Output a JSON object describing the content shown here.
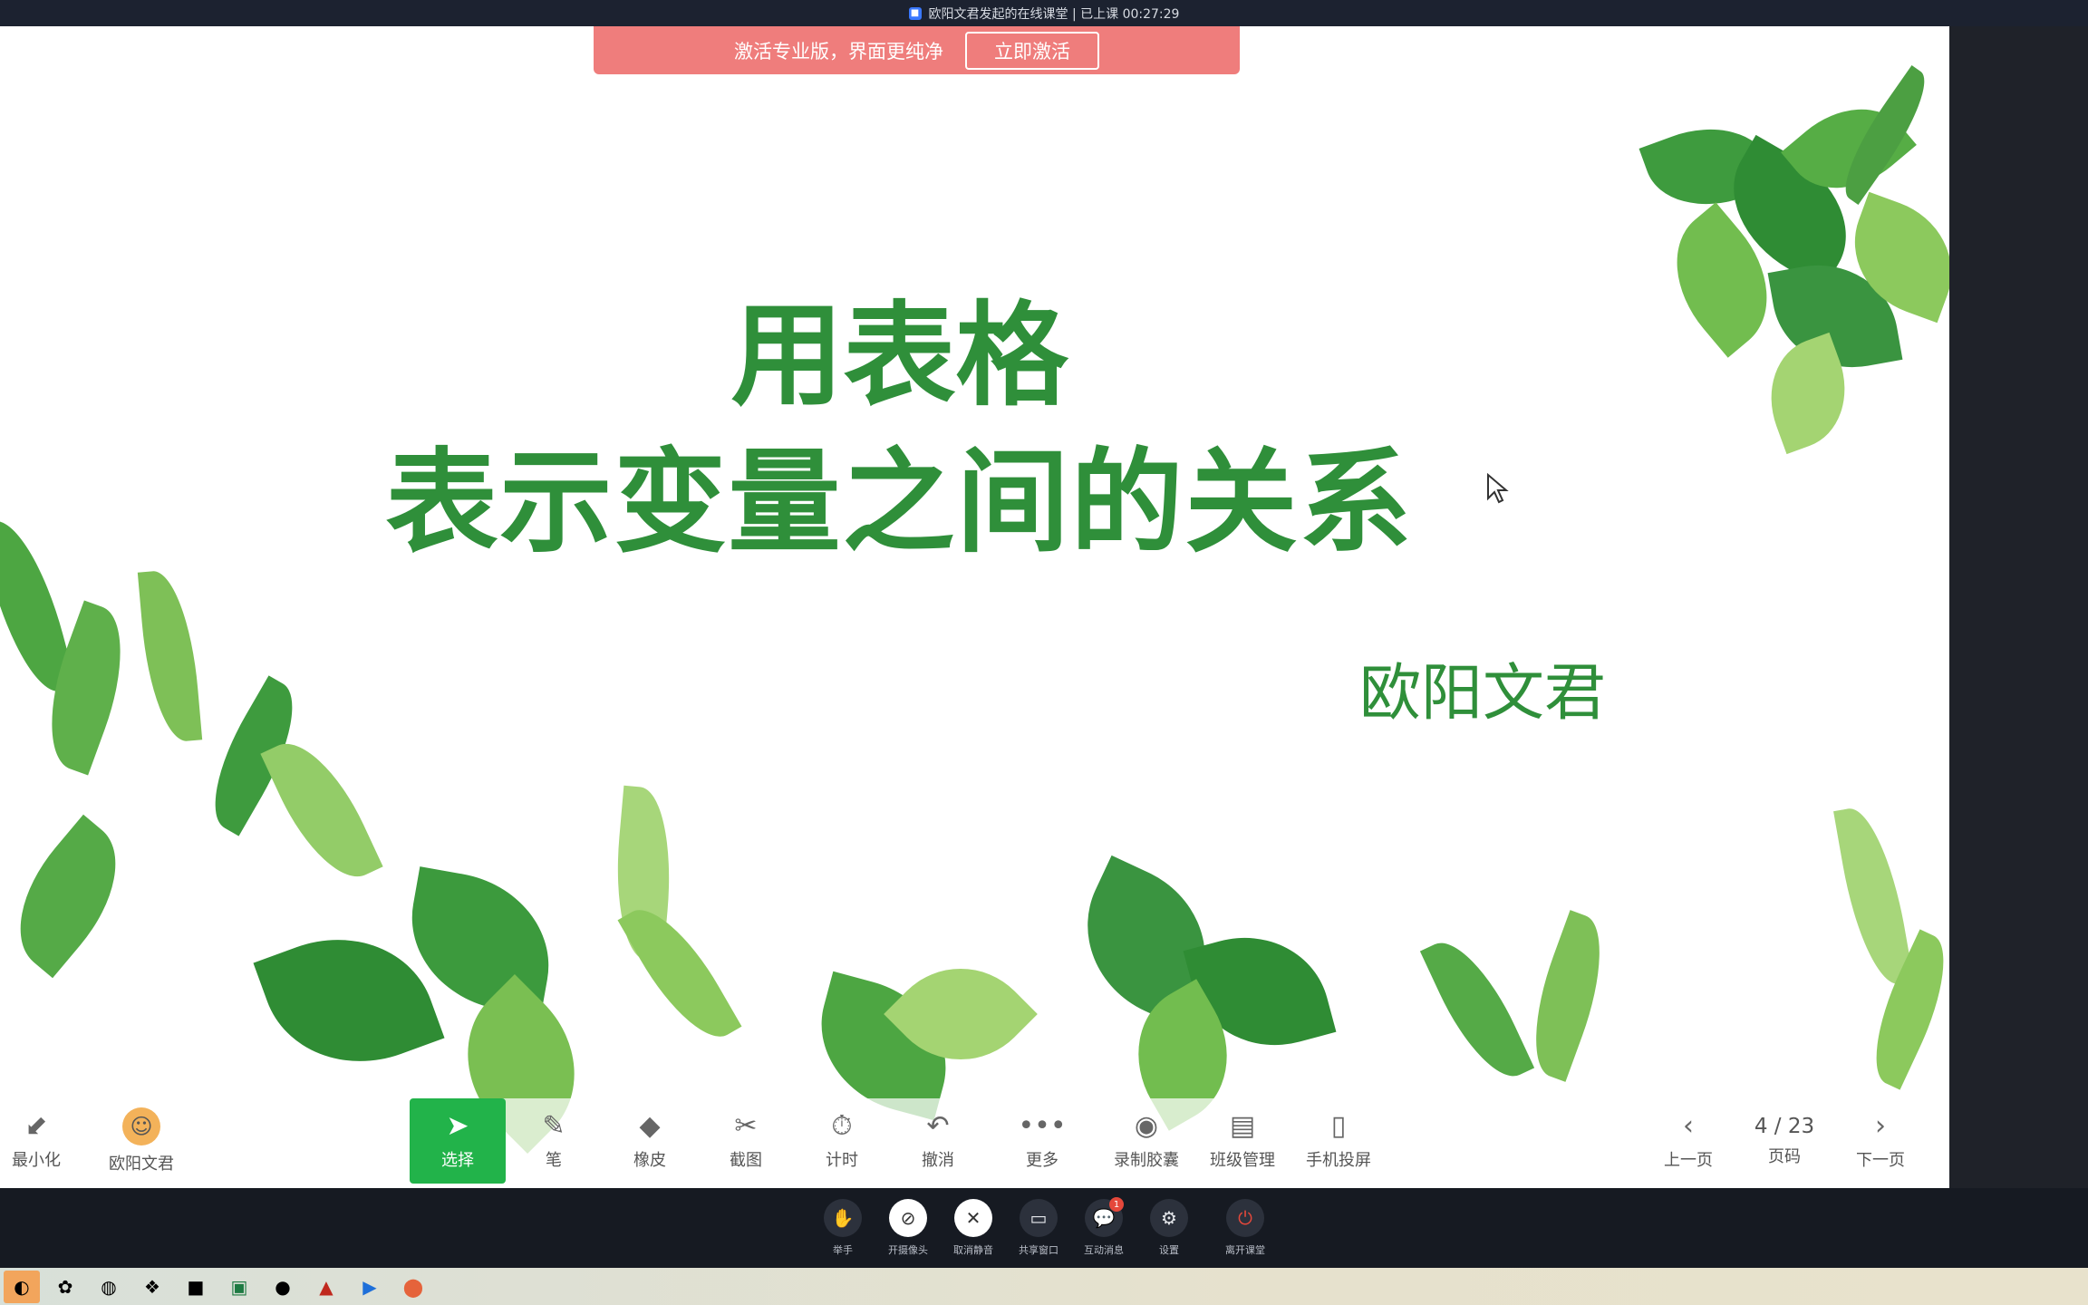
{
  "window": {
    "title": "欧阳文君发起的在线课堂 | 已上课 00:27:29"
  },
  "promo": {
    "message": "激活专业版，界面更纯净",
    "button": "立即激活"
  },
  "slide": {
    "title_line1": "用表格",
    "title_line2": "表示变量之间的关系",
    "author": "欧阳文君"
  },
  "toolbar": {
    "minimize": "最小化",
    "user": "欧阳文君",
    "select": "选择",
    "pen": "笔",
    "eraser": "橡皮",
    "screenshot": "截图",
    "timer": "计时",
    "undo": "撤消",
    "more": "更多",
    "record": "录制胶囊",
    "class_manage": "班级管理",
    "phone_cast": "手机投屏",
    "prev_page": "上一页",
    "page_indicator": "4 / 23",
    "page_label": "页码",
    "next_page": "下一页"
  },
  "controls": {
    "raise_hand": "举手",
    "camera": "开摄像头",
    "unmute": "取消静音",
    "share_window": "共享窗口",
    "messages": "互动消息",
    "messages_badge": "1",
    "settings": "设置",
    "leave": "离开课堂"
  },
  "colors": {
    "title_green": "#2f8f3a",
    "active_green": "#22b34a",
    "promo_red": "#ef7d7c"
  }
}
